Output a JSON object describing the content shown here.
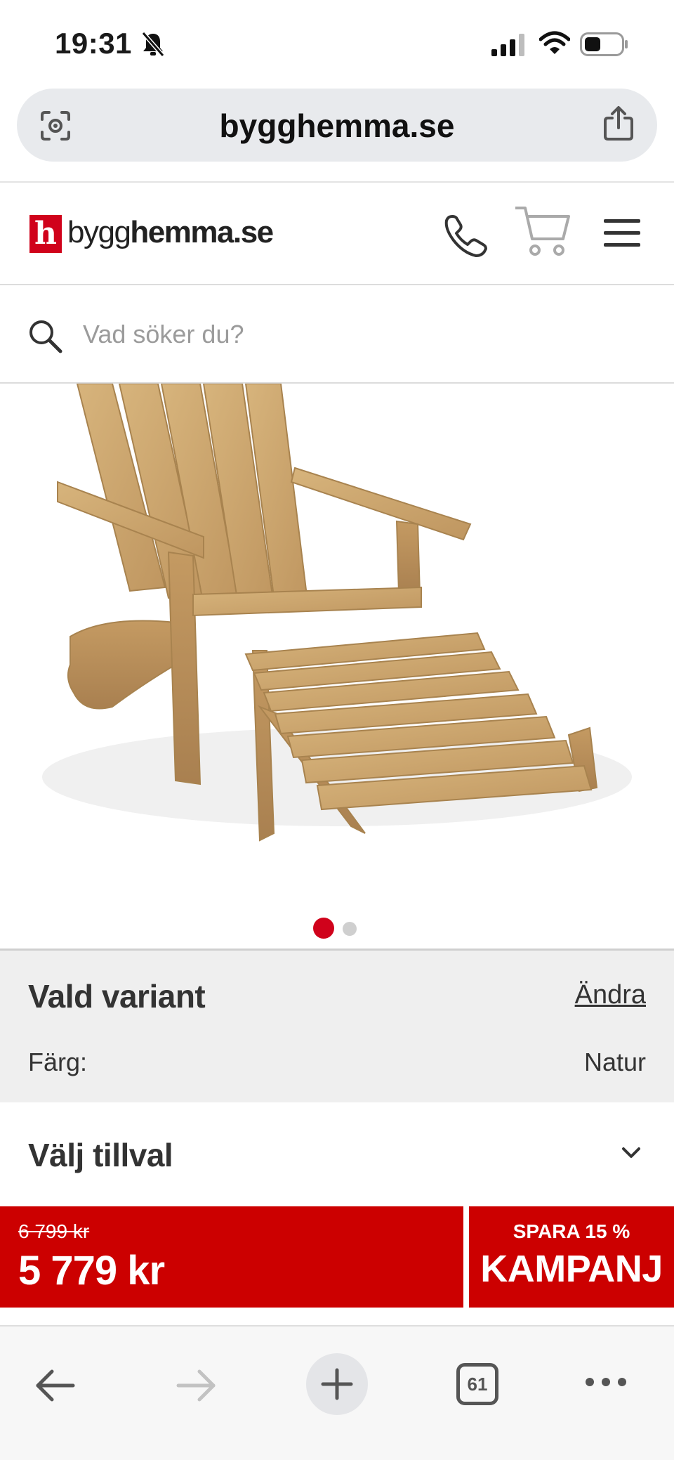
{
  "status_bar": {
    "time": "19:31"
  },
  "browser": {
    "url": "bygghemma.se",
    "tab_count": "61"
  },
  "site_header": {
    "logo_letter": "h",
    "logo_text_light": "bygg",
    "logo_text_bold": "hemma.se"
  },
  "search": {
    "placeholder": "Vad söker du?"
  },
  "gallery": {
    "current_index": 1,
    "total": 2
  },
  "variant": {
    "title": "Vald variant",
    "change_label": "Ändra",
    "color_label": "Färg:",
    "color_value": "Natur"
  },
  "addons": {
    "title": "Välj tillval"
  },
  "price": {
    "old": "6 799 kr",
    "current": "5 779 kr",
    "save_label": "SPARA 15 %",
    "campaign_label": "KAMPANJ"
  },
  "icons": [
    "bell-muted-icon",
    "signal-icon",
    "wifi-icon",
    "battery-icon",
    "lens-icon",
    "share-icon",
    "phone-icon",
    "cart-icon",
    "menu-icon",
    "search-icon",
    "chevron-down-icon",
    "back-arrow-icon",
    "forward-arrow-icon",
    "plus-icon",
    "more-icon"
  ],
  "colors": {
    "brand_red": "#d0021b",
    "price_red": "#cc0000",
    "wood": "#c9a56d"
  }
}
